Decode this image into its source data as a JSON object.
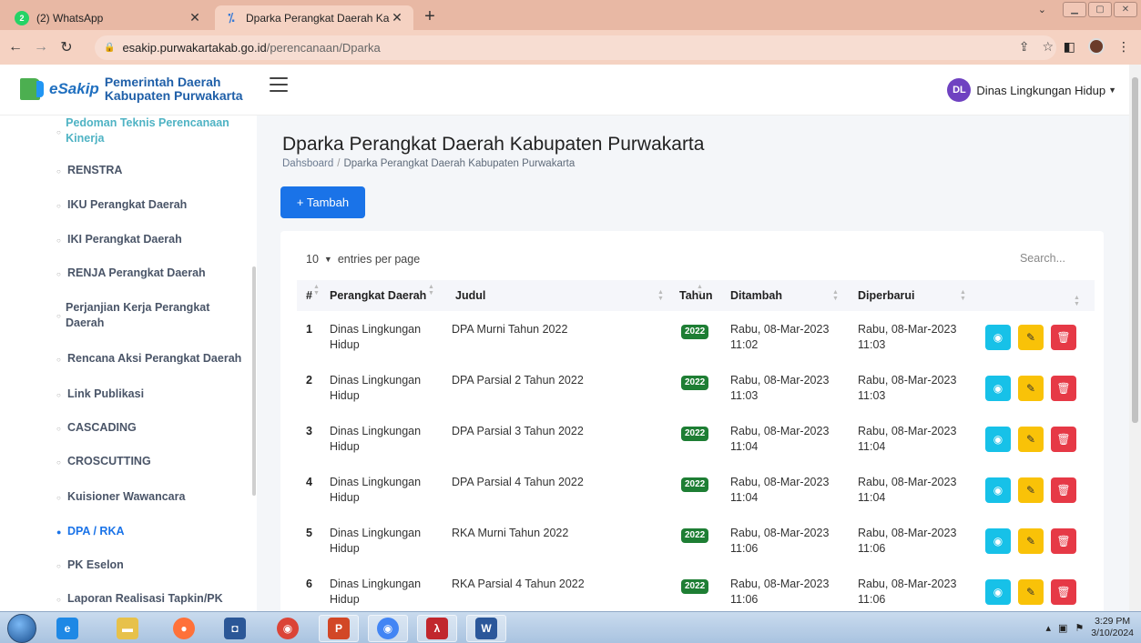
{
  "browser": {
    "tabs": [
      {
        "title": "(2) WhatsApp",
        "badge": "2"
      },
      {
        "title": "Dparka Perangkat Daerah Kabupa"
      }
    ],
    "url_host": "esakip.purwakartakab.go.id",
    "url_path": "/perencanaan/Dparka"
  },
  "header": {
    "brand_short": "eSakip",
    "brand_line1": "Pemerintah Daerah",
    "brand_line2": "Kabupaten Purwakarta",
    "user_initials": "DL",
    "user_name": "Dinas Lingkungan Hidup"
  },
  "sidebar": {
    "items": [
      {
        "label": "Pedoman Teknis Perencanaan Kinerja"
      },
      {
        "label": "RENSTRA"
      },
      {
        "label": "IKU Perangkat Daerah"
      },
      {
        "label": "IKI Perangkat Daerah"
      },
      {
        "label": "RENJA Perangkat Daerah"
      },
      {
        "label": "Perjanjian Kerja Perangkat Daerah"
      },
      {
        "label": "Rencana Aksi Perangkat Daerah"
      },
      {
        "label": "Link Publikasi"
      },
      {
        "label": "CASCADING"
      },
      {
        "label": "CROSCUTTING"
      },
      {
        "label": "Kuisioner Wawancara"
      },
      {
        "label": "DPA / RKA"
      },
      {
        "label": "PK Eselon"
      },
      {
        "label": "Laporan Realisasi Tapkin/PK"
      }
    ],
    "active_index": 11
  },
  "main": {
    "title": "Dparka Perangkat Daerah Kabupaten Purwakarta",
    "breadcrumb_home": "Dahsboard",
    "breadcrumb_sep": "/",
    "breadcrumb_current": "Dparka Perangkat Daerah Kabupaten Purwakarta",
    "add_button": "+ Tambah",
    "entries_value": "10",
    "entries_label": "entries per page",
    "search_placeholder": "Search...",
    "columns": [
      "#",
      "Perangkat Daerah",
      "Judul",
      "Tahun",
      "Ditambah",
      "Diperbarui"
    ],
    "rows": [
      {
        "no": "1",
        "pd1": "Dinas Lingkungan",
        "pd2": "Hidup",
        "judul": "DPA Murni Tahun 2022",
        "tahun": "2022",
        "add1": "Rabu, 08-Mar-2023",
        "add2": "11:02",
        "upd1": "Rabu, 08-Mar-2023",
        "upd2": "11:03"
      },
      {
        "no": "2",
        "pd1": "Dinas Lingkungan",
        "pd2": "Hidup",
        "judul": "DPA Parsial 2 Tahun 2022",
        "tahun": "2022",
        "add1": "Rabu, 08-Mar-2023",
        "add2": "11:03",
        "upd1": "Rabu, 08-Mar-2023",
        "upd2": "11:03"
      },
      {
        "no": "3",
        "pd1": "Dinas Lingkungan",
        "pd2": "Hidup",
        "judul": "DPA Parsial 3 Tahun 2022",
        "tahun": "2022",
        "add1": "Rabu, 08-Mar-2023",
        "add2": "11:04",
        "upd1": "Rabu, 08-Mar-2023",
        "upd2": "11:04"
      },
      {
        "no": "4",
        "pd1": "Dinas Lingkungan",
        "pd2": "Hidup",
        "judul": "DPA Parsial 4 Tahun 2022",
        "tahun": "2022",
        "add1": "Rabu, 08-Mar-2023",
        "add2": "11:04",
        "upd1": "Rabu, 08-Mar-2023",
        "upd2": "11:04"
      },
      {
        "no": "5",
        "pd1": "Dinas Lingkungan",
        "pd2": "Hidup",
        "judul": "RKA Murni Tahun 2022",
        "tahun": "2022",
        "add1": "Rabu, 08-Mar-2023",
        "add2": "11:06",
        "upd1": "Rabu, 08-Mar-2023",
        "upd2": "11:06"
      },
      {
        "no": "6",
        "pd1": "Dinas Lingkungan",
        "pd2": "Hidup",
        "judul": "RKA Parsial 4 Tahun 2022",
        "tahun": "2022",
        "add1": "Rabu, 08-Mar-2023",
        "add2": "11:06",
        "upd1": "Rabu, 08-Mar-2023",
        "upd2": "11:06"
      }
    ]
  },
  "taskbar": {
    "time": "3:29 PM",
    "date": "3/10/2024"
  },
  "colors": {
    "primary": "#1a73e8",
    "view": "#17c1e8",
    "edit": "#f9c208",
    "delete": "#e63946",
    "year_badge": "#1e7e34",
    "browser_frame": "#e8b8a4"
  }
}
